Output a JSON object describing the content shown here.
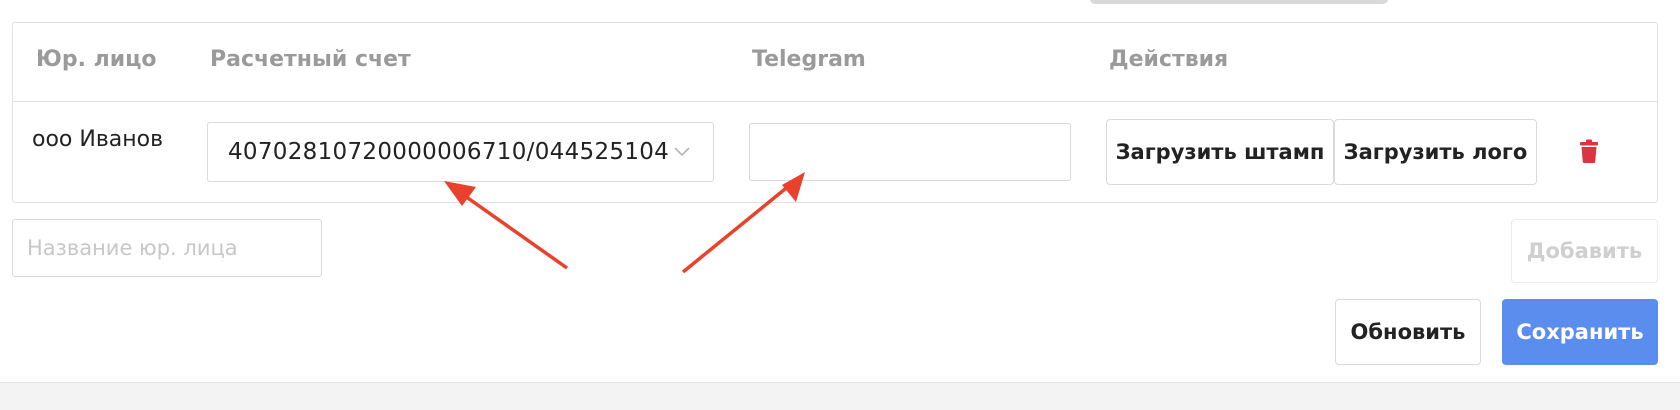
{
  "table": {
    "headers": {
      "legal_entity": "Юр. лицо",
      "account": "Расчетный счет",
      "telegram": "Telegram",
      "actions": "Действия"
    },
    "rows": [
      {
        "legal_entity": "ооо Иванов",
        "account_selected": "40702810720000006710/044525104",
        "telegram_value": "",
        "upload_stamp_label": "Загрузить штамп",
        "upload_logo_label": "Загрузить лого",
        "delete_icon": "trash-icon"
      }
    ]
  },
  "add_form": {
    "name_placeholder": "Название юр. лица",
    "add_label": "Добавить"
  },
  "footer": {
    "refresh_label": "Обновить",
    "save_label": "Сохранить"
  },
  "colors": {
    "primary": "#5b8def",
    "danger": "#d9343f",
    "annotation_arrow": "#e8412c"
  }
}
